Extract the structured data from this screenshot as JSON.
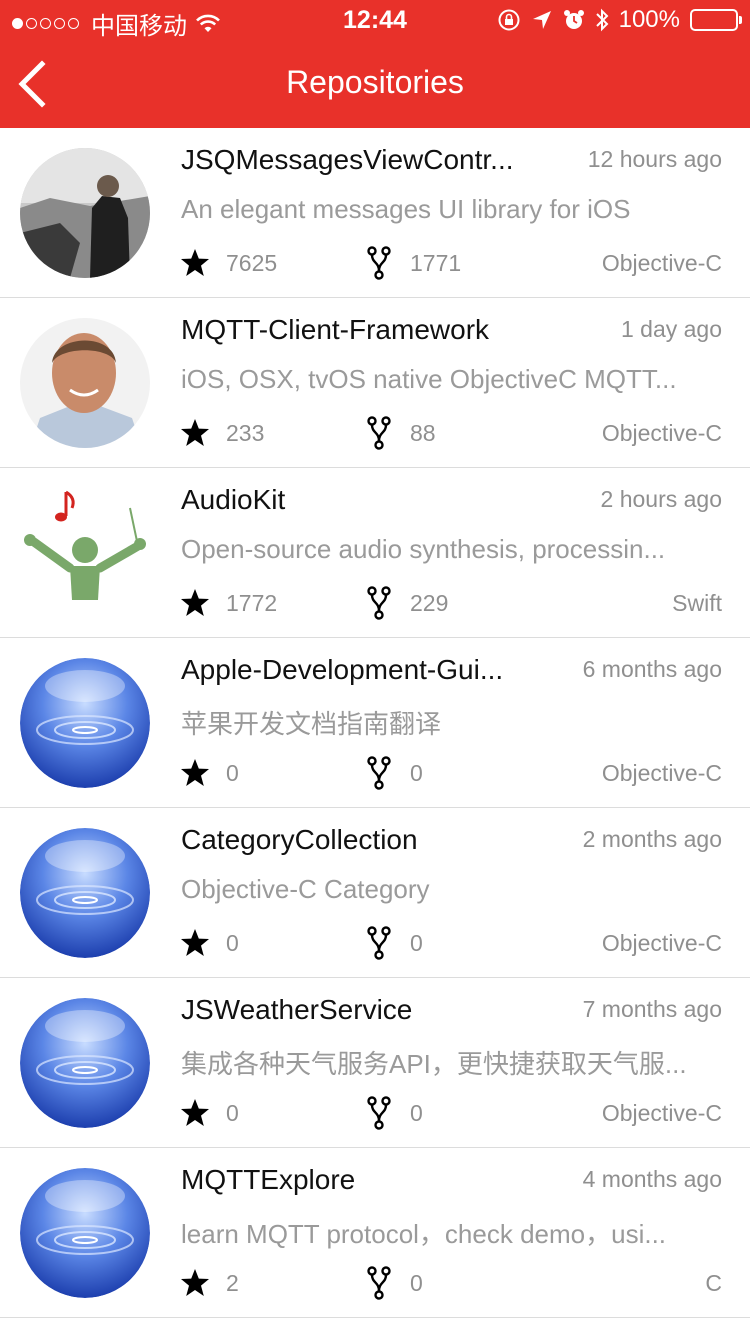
{
  "status_bar": {
    "carrier": "中国移动",
    "time": "12:44",
    "battery_percent": "100%"
  },
  "nav": {
    "title": "Repositories",
    "back_icon": "chevron-left-icon"
  },
  "colors": {
    "header": "#e8312a",
    "secondary_text": "#8f8f8f",
    "divider": "#dcdcdc"
  },
  "repos": [
    {
      "name": "JSQMessagesViewContr...",
      "time": "12 hours ago",
      "description": "An elegant messages UI library for iOS",
      "stars": "7625",
      "forks": "1771",
      "language": "Objective-C",
      "avatar": "photo-man-outdoors"
    },
    {
      "name": "MQTT-Client-Framework",
      "time": "1 day ago",
      "description": "iOS, OSX, tvOS native ObjectiveC MQTT...",
      "stars": "233",
      "forks": "88",
      "language": "Objective-C",
      "avatar": "photo-man-portrait"
    },
    {
      "name": "AudioKit",
      "time": "2 hours ago",
      "description": "Open-source audio synthesis, processin...",
      "stars": "1772",
      "forks": "229",
      "language": "Swift",
      "avatar": "audiokit-logo"
    },
    {
      "name": "Apple-Development-Gui...",
      "time": "6 months ago",
      "description": "苹果开发文档指南翻译",
      "stars": "0",
      "forks": "0",
      "language": "Objective-C",
      "avatar": "water-sphere"
    },
    {
      "name": "CategoryCollection",
      "time": "2 months ago",
      "description": "Objective-C Category",
      "stars": "0",
      "forks": "0",
      "language": "Objective-C",
      "avatar": "water-sphere"
    },
    {
      "name": "JSWeatherService",
      "time": "7 months ago",
      "description": "集成各种天气服务API，更快捷获取天气服...",
      "stars": "0",
      "forks": "0",
      "language": "Objective-C",
      "avatar": "water-sphere"
    },
    {
      "name": "MQTTExplore",
      "time": "4 months ago",
      "description": "learn MQTT protocol，check demo，usi...",
      "stars": "2",
      "forks": "0",
      "language": "C",
      "avatar": "water-sphere"
    }
  ]
}
